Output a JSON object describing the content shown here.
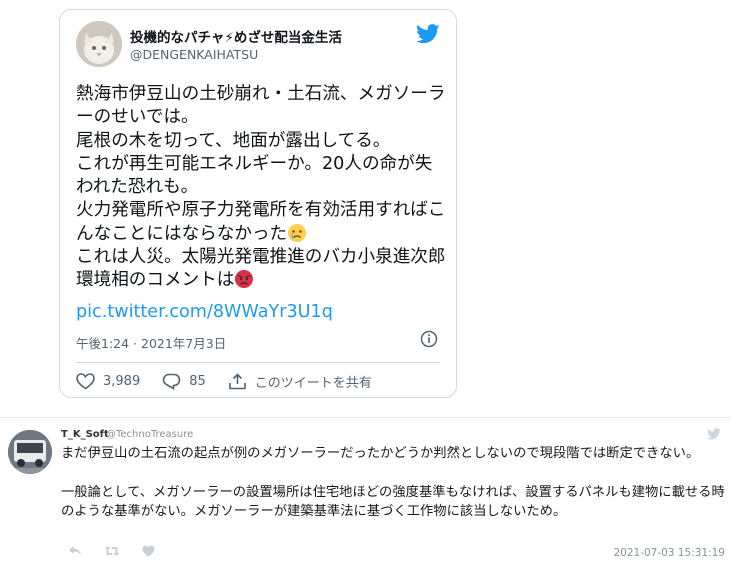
{
  "tweet": {
    "display_name": "投機的なパチャ⚡めざせ配当金生活",
    "handle": "@DENGENKAIHATSU",
    "body_lines": [
      "熱海市伊豆山の土砂崩れ・土石流、メガソーラーのせいでは。",
      "尾根の木を切って、地面が露出してる。",
      "これが再生可能エネルギーか。20人の命が失われた恐れも。",
      "火力発電所や原子力発電所を有効活用すればこんなことにはならなかった",
      "これは人災。太陽光発電推進のバカ小泉進次郎環境相のコメントは"
    ],
    "link": "pic.twitter.com/8WWaYr3U1q",
    "timestamp": "午後1:24 · 2021年7月3日",
    "likes": "3,989",
    "replies": "85",
    "share_label": "このツイートを共有",
    "colors": {
      "accent": "#1d9bf0",
      "like": "#536471"
    },
    "icons": [
      "twitter-bird-icon",
      "crying-emoji-icon",
      "angry-emoji-icon",
      "info-icon",
      "heart-icon",
      "reply-bubble-icon",
      "share-icon"
    ]
  },
  "comment": {
    "user": "T_K_Soft",
    "handle": "@TechnoTreasure",
    "text": "まだ伊豆山の土石流の起点が例のメガソーラーだったかどうか判然としないので現段階では断定できない。\n\n一般論として、メガソーラーの設置場所は住宅地ほどの強度基準もなければ、設置するパネルも建物に載せる時のような基準がない。メガソーラーが建築基準法に基づく工作物に該当しないため。",
    "datetime": "2021-07-03 15:31:19",
    "icons": [
      "reply-icon",
      "retweet-icon",
      "like-icon",
      "twitter-bird-icon"
    ]
  }
}
